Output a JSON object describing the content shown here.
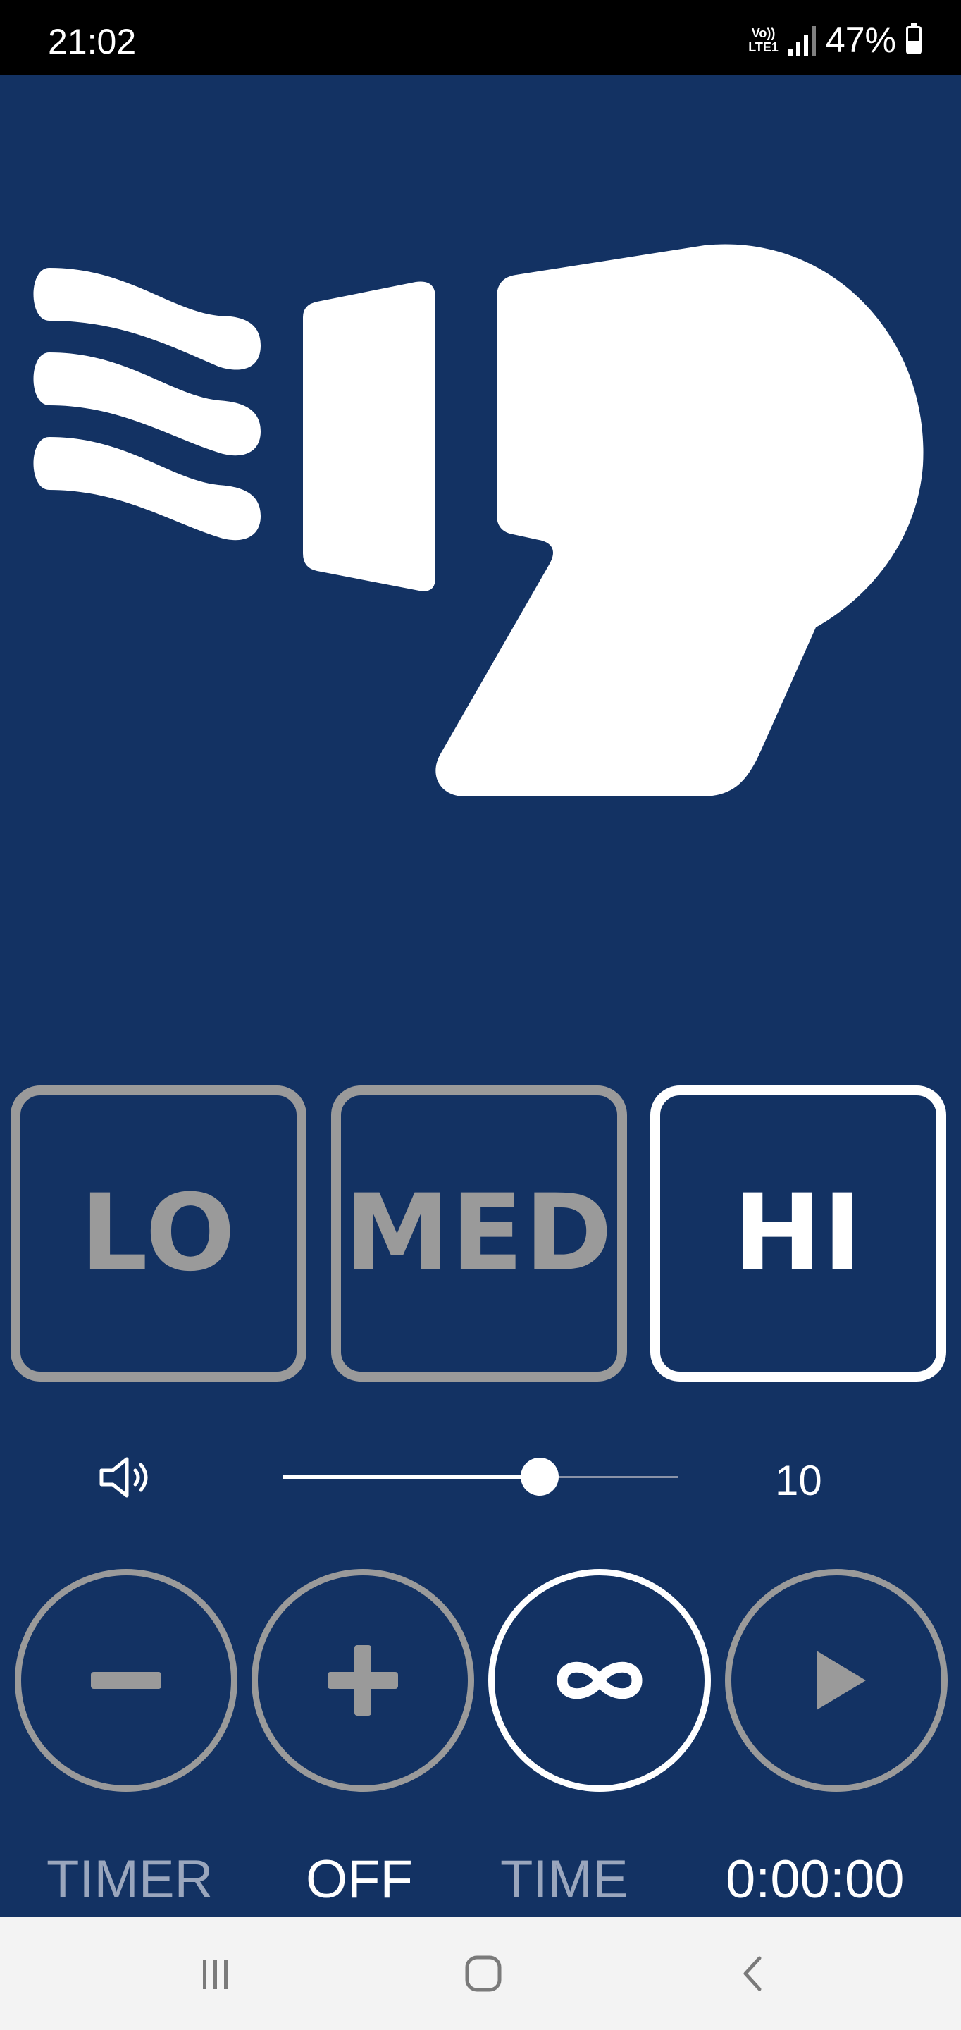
{
  "status_bar": {
    "time": "21:02",
    "volte_top": "Vo))",
    "volte_bottom": "LTE1",
    "battery_percent": "47%",
    "battery_level": 0.47
  },
  "hero": {
    "icon": "hair-dryer-icon",
    "color": "#ffffff"
  },
  "speed": {
    "buttons": [
      {
        "label": "LO",
        "active": false
      },
      {
        "label": "MED",
        "active": false
      },
      {
        "label": "HI",
        "active": true
      }
    ]
  },
  "volume": {
    "icon": "speaker-icon",
    "value": "10",
    "level_fraction": 0.65
  },
  "controls": [
    {
      "icon": "minus-icon",
      "active": false
    },
    {
      "icon": "plus-icon",
      "active": false
    },
    {
      "icon": "infinity-icon",
      "active": true
    },
    {
      "icon": "play-icon",
      "active": false
    }
  ],
  "info": {
    "timer_label": "TIMER",
    "timer_value": "OFF",
    "time_label": "TIME",
    "time_value": "0:00:00"
  },
  "nav": {
    "recents": "recents-icon",
    "home": "home-icon",
    "back": "back-icon"
  },
  "colors": {
    "background": "#133263",
    "inactive": "#9a9a9a",
    "active": "#ffffff",
    "nav_background": "#f3f3f3",
    "nav_icon": "#7a7a7a"
  }
}
